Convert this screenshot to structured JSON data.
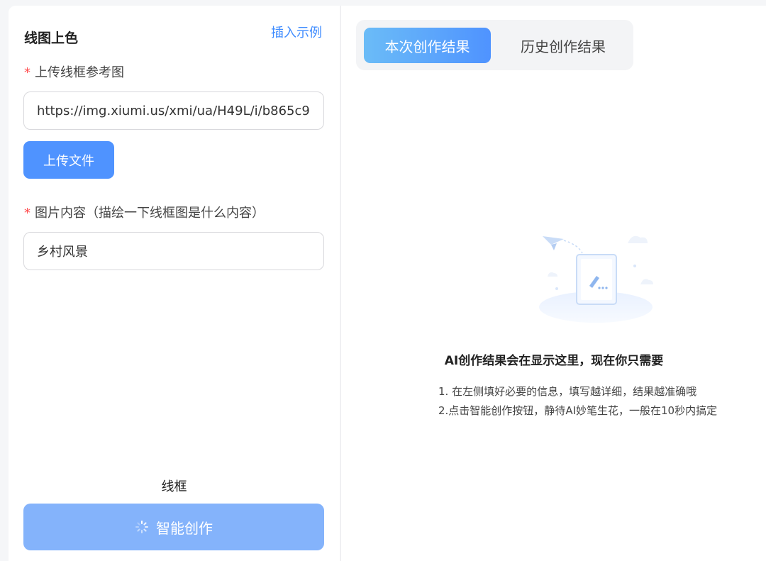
{
  "left": {
    "title": "线图上色",
    "insert_example": "插入示例",
    "wireframe_label": "上传线框参考图",
    "required_mark": "*",
    "url_value": "https://img.xiumi.us/xmi/ua/H49L/i/b865c9",
    "upload_button": "上传文件",
    "content_label": "图片内容（描绘一下线框图是什么内容）",
    "content_value": "乡村风景",
    "style_label": "线框",
    "create_button": "智能创作"
  },
  "right": {
    "tabs": [
      {
        "label": "本次创作结果",
        "active": true
      },
      {
        "label": "历史创作结果",
        "active": false
      }
    ],
    "empty_title": "AI创作结果会在显示这里，现在你只需要",
    "tips": [
      "1. 在左侧填好必要的信息，填写越详细，结果越准确哦",
      "2.点击智能创作按钮，静待AI妙笔生花，一般在10秒内搞定"
    ]
  },
  "colors": {
    "accent": "#4f93ff",
    "accent_light": "#84b3fb",
    "link": "#3f8cff",
    "required": "#ff4d4f"
  },
  "icons": {
    "create_button_icon": "loading-spinner-icon",
    "empty_state": "paper-plane-document-illustration"
  }
}
